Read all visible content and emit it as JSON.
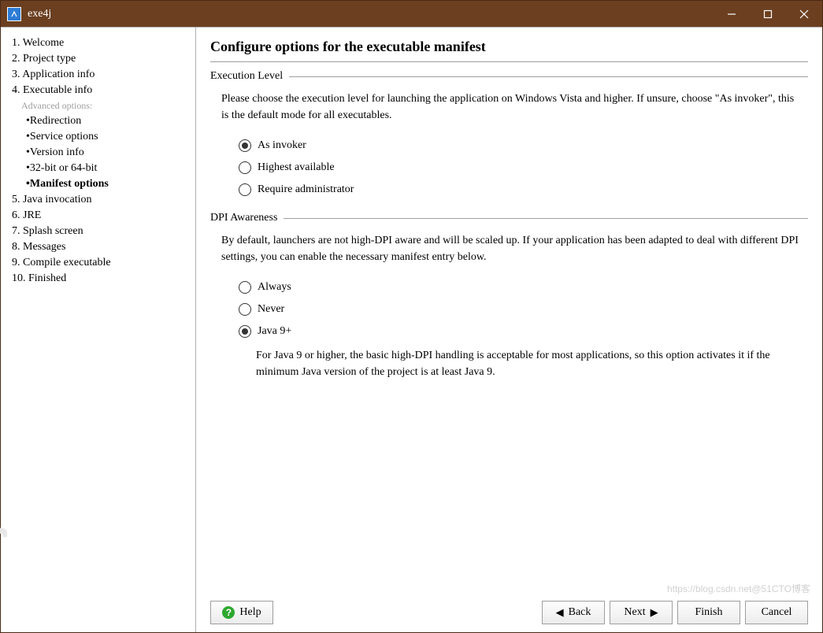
{
  "window": {
    "title": "exe4j"
  },
  "sidebar": {
    "brand": "exe4j",
    "items": [
      {
        "num": "1.",
        "label": "Welcome"
      },
      {
        "num": "2.",
        "label": "Project type"
      },
      {
        "num": "3.",
        "label": "Application info"
      },
      {
        "num": "4.",
        "label": "Executable info"
      }
    ],
    "advanced_header": "Advanced options:",
    "advanced_items": [
      {
        "label": "Redirection"
      },
      {
        "label": "Service options"
      },
      {
        "label": "Version info"
      },
      {
        "label": "32-bit or 64-bit"
      },
      {
        "label": "Manifest options",
        "current": true
      }
    ],
    "items_after": [
      {
        "num": "5.",
        "label": "Java invocation"
      },
      {
        "num": "6.",
        "label": "JRE"
      },
      {
        "num": "7.",
        "label": "Splash screen"
      },
      {
        "num": "8.",
        "label": "Messages"
      },
      {
        "num": "9.",
        "label": "Compile executable"
      },
      {
        "num": "10.",
        "label": "Finished"
      }
    ]
  },
  "main": {
    "title": "Configure options for the executable manifest",
    "group1": {
      "label": "Execution Level",
      "desc": "Please choose the execution level for launching the application on Windows Vista and higher. If unsure, choose \"As invoker\", this is the default mode for all executables.",
      "options": [
        {
          "label": "As invoker",
          "checked": true
        },
        {
          "label": "Highest available",
          "checked": false
        },
        {
          "label": "Require administrator",
          "checked": false
        }
      ]
    },
    "group2": {
      "label": "DPI Awareness",
      "desc": "By default, launchers are not high-DPI aware and will be scaled up. If your application has been adapted to deal with different DPI settings, you can enable the necessary manifest entry below.",
      "options": [
        {
          "label": "Always",
          "checked": false
        },
        {
          "label": "Never",
          "checked": false
        },
        {
          "label": "Java 9+",
          "checked": true
        }
      ],
      "sub_desc": "For Java 9 or higher, the basic high-DPI handling is acceptable for most applications, so this option activates it if the minimum Java version of the project is at least Java 9."
    }
  },
  "buttons": {
    "help": "Help",
    "back": "Back",
    "next": "Next",
    "finish": "Finish",
    "cancel": "Cancel"
  },
  "watermark": "https://blog.csdn.net@51CTO博客"
}
